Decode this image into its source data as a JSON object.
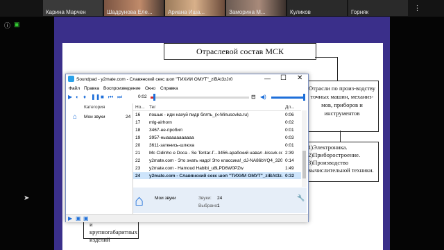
{
  "participants": [
    {
      "name": "Карина Марчен",
      "color": "#3d3d3d"
    },
    {
      "name": "Шадрунова Еле...",
      "color": "#6b4a3a"
    },
    {
      "name": "Ариана Иша...",
      "color": "#8a6a52"
    },
    {
      "name": "Заморина М...",
      "color": "#5a4a44"
    },
    {
      "name": "Куликов",
      "color": "#2e2e2e"
    },
    {
      "name": "Горняк",
      "color": "#2e2e2e"
    }
  ],
  "slide": {
    "title": "Отраслевой состав МСК",
    "box_right_1": "Отрасли по произ-водству точных машин, механиз-мов, приборов и инструментов",
    "box_right_2": [
      "1)Электроника.",
      "2)Приборостроение.",
      "3)Производство вычислительной техники."
    ],
    "box_left_bottom": [
      "и крупногабаритных",
      "изделий"
    ]
  },
  "soundpad": {
    "title": "Soundpad - y2mate.com - Славянский секс шоп \"ТИХИЙ ОМУТ\"_ziBAt3zJr0",
    "menu": [
      "Файл",
      "Правка",
      "Воспроизведение",
      "Окно",
      "Справка"
    ],
    "time": "0:02",
    "columns": {
      "category": "Категория",
      "number": "Но...",
      "title": "Тег",
      "duration": "Дл..."
    },
    "category": {
      "label": "Мои звуки",
      "count": "24"
    },
    "rows": [
      {
        "n": "16",
        "t": "пошык - иди нахуй пидр блять_(x-Minusovka.ru)",
        "d": "0:06"
      },
      {
        "n": "17",
        "t": "mlg-airhorn",
        "d": "0:02"
      },
      {
        "n": "18",
        "t": "3467-не-пробил",
        "d": "0:01"
      },
      {
        "n": "19",
        "t": "3957-ныааааааааааа",
        "d": "0:03"
      },
      {
        "n": "20",
        "t": "3611-заткнись-шлюха",
        "d": "0:01"
      },
      {
        "n": "21",
        "t": "Mc Cidinho e Doca - Se Tentar-Г...3456-арабский навал -kissvk.com",
        "d": "2:39"
      },
      {
        "n": "22",
        "t": "y2mate.com - Это знать надо! Это классика!_dJ-NA86bYQ4_320kbps",
        "d": "0:14"
      },
      {
        "n": "23",
        "t": "y2mate.com - Hamoud Habibi_u8LPD6W0PZw",
        "d": "1:49"
      },
      {
        "n": "24",
        "t": "y2mate.com - Славянский секс шоп \"ТИХИЙ ОМУТ\"_ziBAt3zJr0",
        "d": "0:32"
      }
    ],
    "info": {
      "name": "Мои звуки",
      "sounds_label": "Звуки:",
      "sounds_value": "24",
      "selected_label": "Выбрано:",
      "selected_value": "1"
    }
  },
  "colors": {
    "stage": "#3a2f8a",
    "selection": "#cde4fb",
    "accent": "#1e6fd9",
    "progress": "#d32f2f"
  }
}
